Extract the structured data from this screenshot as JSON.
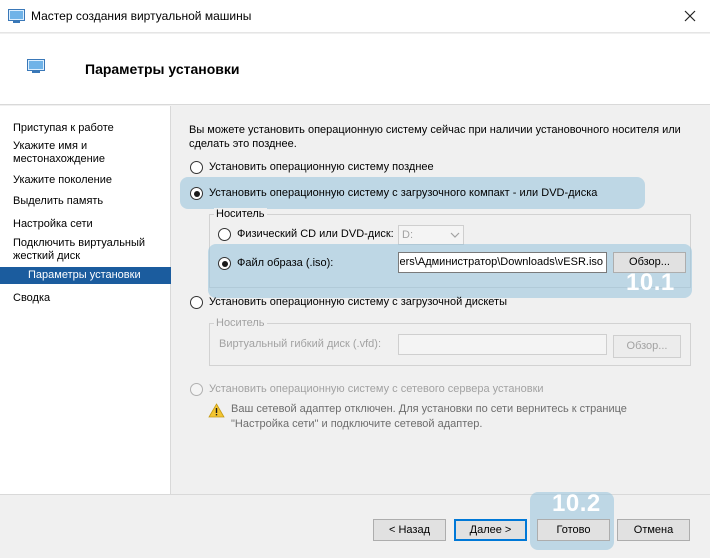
{
  "window": {
    "title": "Мастер создания виртуальной машины"
  },
  "header": {
    "title": "Параметры установки"
  },
  "sidebar": {
    "items": [
      {
        "label": "Приступая к работе"
      },
      {
        "label": "Укажите имя и местонахождение"
      },
      {
        "label": "Укажите поколение"
      },
      {
        "label": "Выделить память"
      },
      {
        "label": "Настройка сети"
      },
      {
        "label": "Подключить виртуальный жесткий диск"
      },
      {
        "label": "Параметры установки",
        "selected": true
      },
      {
        "label": "Сводка"
      }
    ]
  },
  "main": {
    "description": "Вы можете установить операционную систему сейчас при наличии установочного носителя или\nсделать это позднее.",
    "options": {
      "later": {
        "label": "Установить операционную систему позднее",
        "checked": false
      },
      "cd": {
        "label": "Установить операционную систему с загрузочного компакт - или DVD-диска",
        "checked": true
      },
      "floppy": {
        "label": "Установить операционную систему с загрузочной дискеты",
        "checked": false
      },
      "network": {
        "label": "Установить операционную систему с сетевого сервера установки",
        "checked": false,
        "disabled": true
      }
    },
    "cd_group": {
      "legend": "Носитель",
      "physical_label": "Физический CD или DVD-диск:",
      "physical_drive": "D:",
      "image_label": "Файл образа (.iso):",
      "image_path": "C:\\Users\\Администратор\\Downloads\\vESR.iso",
      "browse_label": "Обзор..."
    },
    "floppy_group": {
      "legend": "Носитель",
      "vfd_label": "Виртуальный гибкий диск (.vfd):",
      "vfd_value": "",
      "browse_label": "Обзор..."
    },
    "network_warning": "Ваш сетевой адаптер отключен. Для установки по сети вернитесь к странице\n\"Настройка сети\" и подключите сетевой адаптер."
  },
  "annotations": {
    "step_1": "10.1",
    "step_2": "10.2"
  },
  "footer": {
    "back_label": "< Назад",
    "next_label": "Далее >",
    "finish_label": "Готово",
    "cancel_label": "Отмена"
  },
  "colors": {
    "selection": "#1b5c9e",
    "highlight": "#96c3dc",
    "focus": "#0078d7"
  }
}
